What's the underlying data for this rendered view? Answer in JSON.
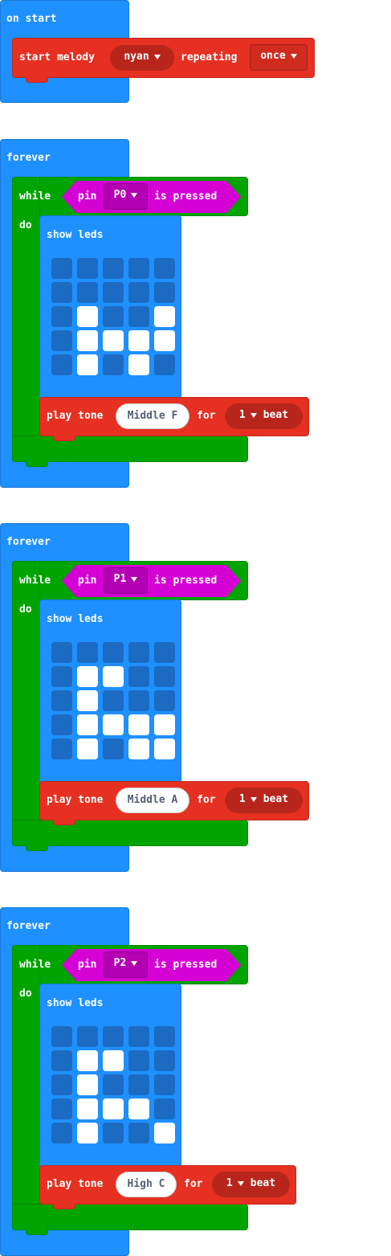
{
  "on_start": {
    "label": "on start",
    "block": {
      "start_label": "start melody",
      "melody": "nyan",
      "repeating_label": "repeating",
      "repeat": "once"
    }
  },
  "forever_blocks": [
    {
      "label": "forever",
      "while_label": "while",
      "pin_label": "pin",
      "pin": "P0",
      "pressed_label": "is pressed",
      "do_label": "do",
      "show_leds_label": "show leds",
      "leds": [
        [
          0,
          0,
          0,
          0,
          0
        ],
        [
          0,
          0,
          0,
          0,
          0
        ],
        [
          0,
          1,
          0,
          0,
          1
        ],
        [
          0,
          1,
          1,
          1,
          1
        ],
        [
          0,
          1,
          0,
          1,
          0
        ]
      ],
      "play_label": "play tone",
      "note": "Middle F",
      "for_label": "for",
      "beat_value": "1",
      "beat_label": "beat"
    },
    {
      "label": "forever",
      "while_label": "while",
      "pin_label": "pin",
      "pin": "P1",
      "pressed_label": "is pressed",
      "do_label": "do",
      "show_leds_label": "show leds",
      "leds": [
        [
          0,
          0,
          0,
          0,
          0
        ],
        [
          0,
          1,
          1,
          0,
          0
        ],
        [
          0,
          1,
          0,
          0,
          0
        ],
        [
          0,
          1,
          1,
          1,
          1
        ],
        [
          0,
          1,
          0,
          1,
          1
        ]
      ],
      "play_label": "play tone",
      "note": "Middle A",
      "for_label": "for",
      "beat_value": "1",
      "beat_label": "beat"
    },
    {
      "label": "forever",
      "while_label": "while",
      "pin_label": "pin",
      "pin": "P2",
      "pressed_label": "is pressed",
      "do_label": "do",
      "show_leds_label": "show leds",
      "leds": [
        [
          0,
          0,
          0,
          0,
          0
        ],
        [
          0,
          1,
          1,
          0,
          0
        ],
        [
          0,
          1,
          0,
          0,
          0
        ],
        [
          0,
          1,
          1,
          1,
          0
        ],
        [
          0,
          1,
          0,
          0,
          1
        ]
      ],
      "play_label": "play tone",
      "note": "High C",
      "for_label": "for",
      "beat_value": "1",
      "beat_label": "beat"
    }
  ],
  "colors": {
    "event": "#1E90FF",
    "music": "#E63022",
    "loop": "#00A400",
    "pins": "#D400D4",
    "led_on": "#ffffff",
    "led_off": "#1c6bc2"
  }
}
